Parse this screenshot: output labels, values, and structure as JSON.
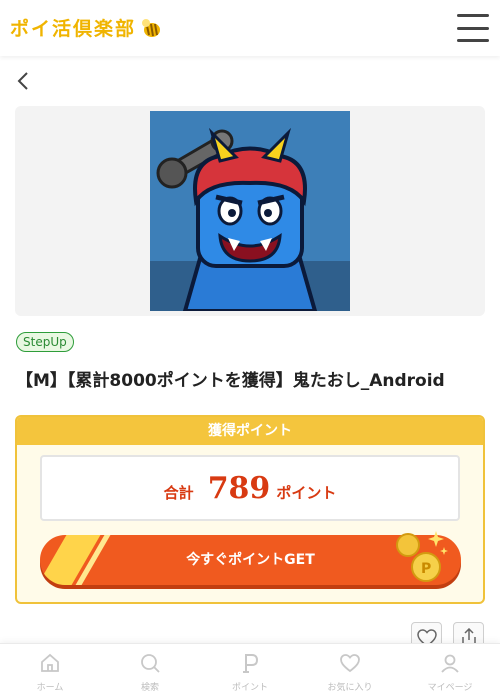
{
  "header": {
    "logo_text": "ポイ活倶楽部",
    "logo_icon": "bee-icon",
    "menu_icon": "hamburger-menu-icon"
  },
  "nav": {
    "back_icon": "chevron-left-icon"
  },
  "offer": {
    "tag": "StepUp",
    "title": "【M】【累計8000ポイントを獲得】鬼たおし_Android",
    "image": "oni-game-icon"
  },
  "points": {
    "header": "獲得ポイント",
    "total_label": "合計",
    "value": "789",
    "unit": "ポイント",
    "button_label": "今すぐポイントGET",
    "coins_icon": "coins-icon"
  },
  "actions": {
    "favorite_icon": "heart-icon",
    "share_icon": "share-icon"
  },
  "tabbar": {
    "items": [
      {
        "label": "ホーム",
        "icon": "home-icon"
      },
      {
        "label": "検索",
        "icon": "search-icon"
      },
      {
        "label": "ポイント",
        "icon": "point-icon"
      },
      {
        "label": "お気に入り",
        "icon": "heart-icon"
      },
      {
        "label": "マイページ",
        "icon": "user-icon"
      }
    ]
  },
  "colors": {
    "accent_yellow": "#f4c53d",
    "button_orange": "#f05a1f",
    "points_red": "#d83a12",
    "tag_green": "#2e9d3a"
  }
}
